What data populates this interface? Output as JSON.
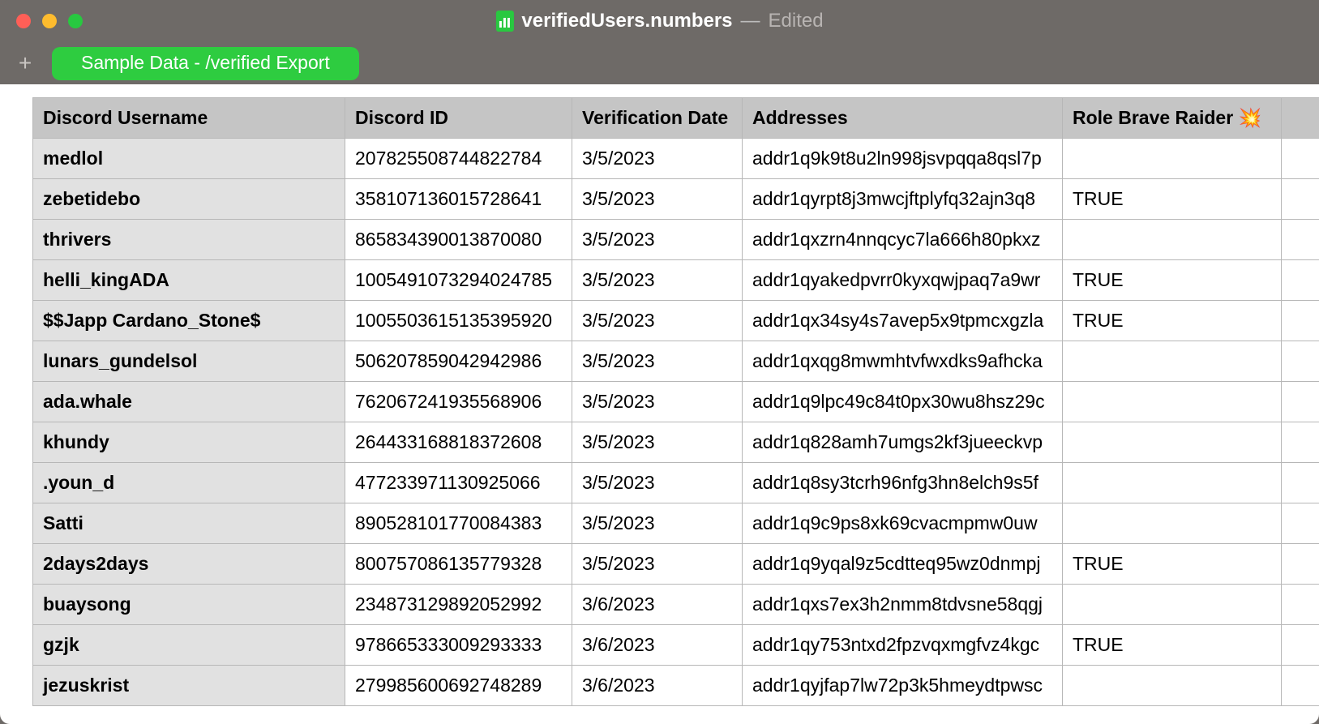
{
  "window": {
    "filename": "verifiedUsers.numbers",
    "separator": "—",
    "status": "Edited"
  },
  "tabs": {
    "active": "Sample Data - /verified Export"
  },
  "table": {
    "headers": {
      "username": "Discord Username",
      "id": "Discord ID",
      "date": "Verification Date",
      "addresses": "Addresses",
      "role": "Role Brave Raider 💥"
    },
    "rows": [
      {
        "username": "medlol",
        "id": "207825508744822784",
        "date": "3/5/2023",
        "address": "addr1q9k9t8u2ln998jsvpqqa8qsl7p",
        "role": ""
      },
      {
        "username": "zebetidebo",
        "id": "358107136015728641",
        "date": "3/5/2023",
        "address": "addr1qyrpt8j3mwcjftplyfq32ajn3q8",
        "role": "TRUE"
      },
      {
        "username": "thrivers",
        "id": "865834390013870080",
        "date": "3/5/2023",
        "address": "addr1qxzrn4nnqcyc7la666h80pkxz",
        "role": ""
      },
      {
        "username": "helli_kingADA",
        "id": "1005491073294024785",
        "date": "3/5/2023",
        "address": "addr1qyakedpvrr0kyxqwjpaq7a9wr",
        "role": "TRUE"
      },
      {
        "username": "$$Japp Cardano_Stone$",
        "id": "1005503615135395920",
        "date": "3/5/2023",
        "address": "addr1qx34sy4s7avep5x9tpmcxgzla",
        "role": "TRUE"
      },
      {
        "username": "lunars_gundelsol",
        "id": "506207859042942986",
        "date": "3/5/2023",
        "address": "addr1qxqg8mwmhtvfwxdks9afhcka",
        "role": ""
      },
      {
        "username": "ada.whale",
        "id": "762067241935568906",
        "date": "3/5/2023",
        "address": "addr1q9lpc49c84t0px30wu8hsz29c",
        "role": ""
      },
      {
        "username": "khundy",
        "id": "264433168818372608",
        "date": "3/5/2023",
        "address": "addr1q828amh7umgs2kf3jueeckvp",
        "role": ""
      },
      {
        "username": ".youn_d",
        "id": "477233971130925066",
        "date": "3/5/2023",
        "address": "addr1q8sy3tcrh96nfg3hn8elch9s5f",
        "role": ""
      },
      {
        "username": "Satti",
        "id": "890528101770084383",
        "date": "3/5/2023",
        "address": "addr1q9c9ps8xk69cvacmpmw0uw",
        "role": ""
      },
      {
        "username": "2days2days",
        "id": "800757086135779328",
        "date": "3/5/2023",
        "address": "addr1q9yqal9z5cdtteq95wz0dnmpj",
        "role": "TRUE"
      },
      {
        "username": "buaysong",
        "id": "234873129892052992",
        "date": "3/6/2023",
        "address": "addr1qxs7ex3h2nmm8tdvsne58qgj",
        "role": ""
      },
      {
        "username": "gzjk",
        "id": "978665333009293333",
        "date": "3/6/2023",
        "address": "addr1qy753ntxd2fpzvqxmgfvz4kgc",
        "role": "TRUE"
      },
      {
        "username": "jezuskrist",
        "id": "279985600692748289",
        "date": "3/6/2023",
        "address": "addr1qyjfap7lw72p3k5hmeydtpwsc",
        "role": ""
      }
    ]
  }
}
